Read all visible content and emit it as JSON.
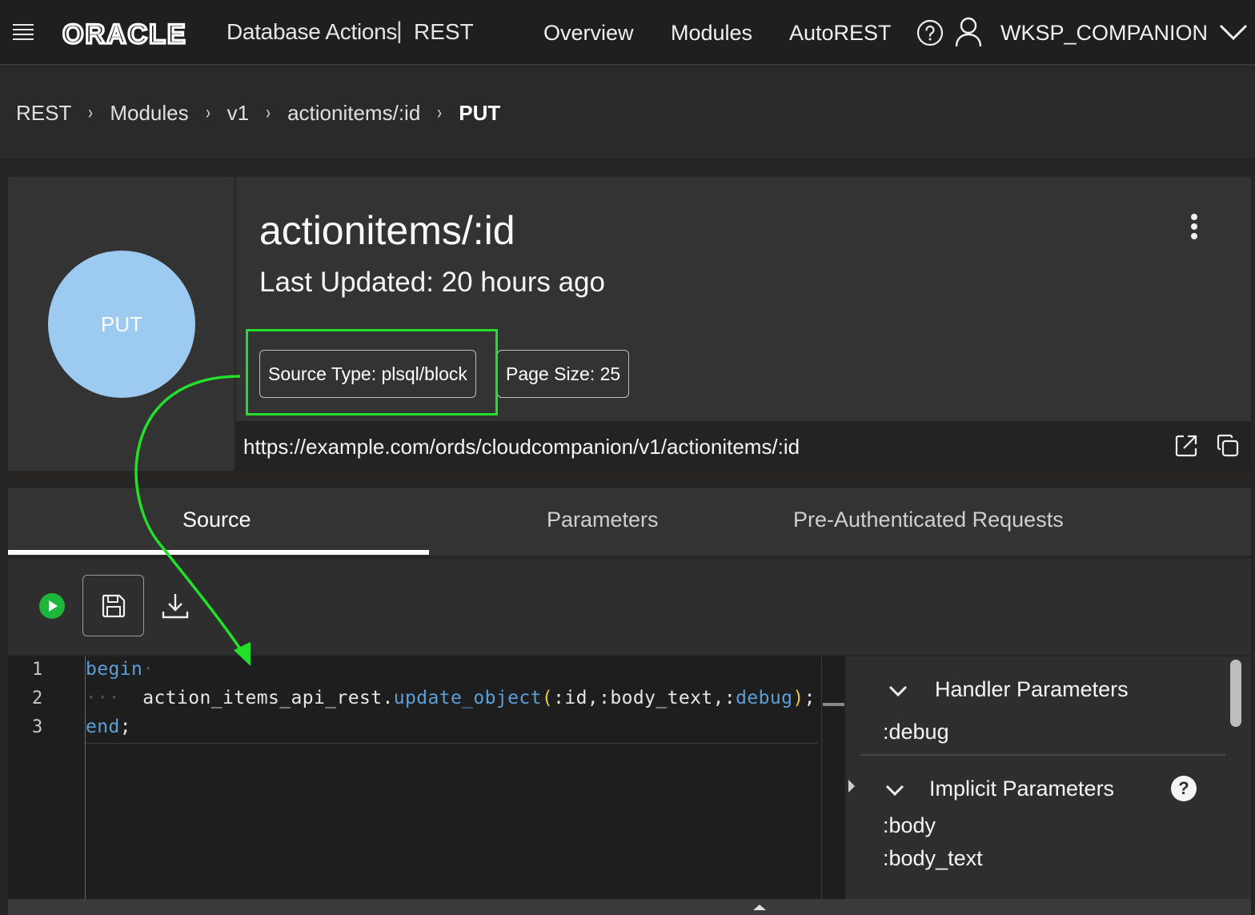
{
  "header": {
    "logo_text": "ORACLE",
    "app_name": "Database Actions",
    "separator": "|",
    "section": "REST",
    "nav": [
      "Overview",
      "Modules",
      "AutoREST"
    ],
    "user": "WKSP_COMPANION"
  },
  "breadcrumb": {
    "items": [
      "REST",
      "Modules",
      "v1",
      "actionitems/:id",
      "PUT"
    ],
    "separator": "›"
  },
  "handler": {
    "method": "PUT",
    "title": "actionitems/:id",
    "last_updated": "Last Updated: 20 hours ago",
    "source_type": "Source Type: plsql/block",
    "page_size": "Page Size: 25",
    "url": "https://example.com/ords/cloudcompanion/v1/actionitems/:id"
  },
  "tabs": [
    "Source",
    "Parameters",
    "Pre-Authenticated Requests"
  ],
  "editor": {
    "line_numbers": [
      "1",
      "2",
      "3"
    ],
    "line1": "begin",
    "line2_prefix": "action_items_api_rest.",
    "line2_fn": "update_object",
    "line2_open": "(",
    "line2_args": ":id,:body_text,:",
    "line2_kw": "debug",
    "line2_close": ")",
    "line2_end": ";",
    "line3_kw": "end",
    "line3_end": ";"
  },
  "parameters": {
    "handler_title": "Handler Parameters",
    "handler_items": [
      ":debug"
    ],
    "implicit_title": "Implicit Parameters",
    "implicit_items": [
      ":body",
      ":body_text"
    ],
    "help_glyph": "?"
  },
  "colors": {
    "method_circle": "#9ccaf0",
    "highlight": "#22e02a",
    "run_button": "#1db53c",
    "keyword": "#5c9fd8",
    "paren": "#e8c84a"
  },
  "icons": [
    "menu-icon",
    "help-icon",
    "user-icon",
    "chevron-down-icon",
    "more-vertical-icon",
    "open-external-icon",
    "copy-icon",
    "run-icon",
    "save-icon",
    "download-icon",
    "question-icon"
  ]
}
